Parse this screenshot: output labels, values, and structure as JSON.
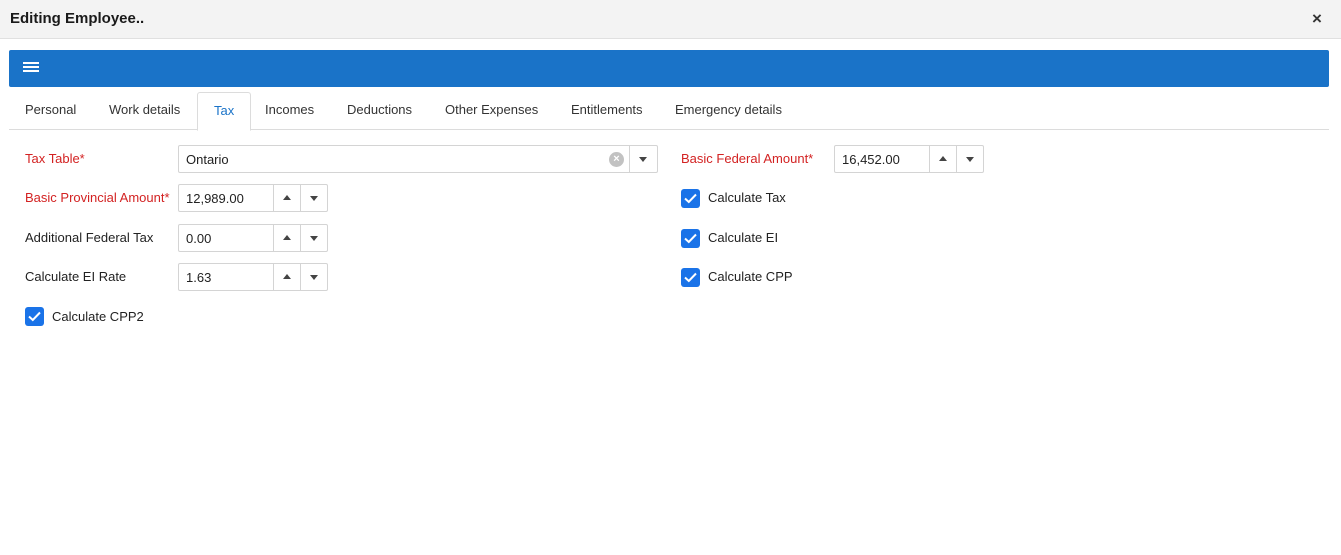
{
  "window": {
    "title": "Editing Employee..",
    "close_label": "×"
  },
  "tabs": [
    {
      "label": "Personal"
    },
    {
      "label": "Work details"
    },
    {
      "label": "Tax"
    },
    {
      "label": "Incomes"
    },
    {
      "label": "Deductions"
    },
    {
      "label": "Other Expenses"
    },
    {
      "label": "Entitlements"
    },
    {
      "label": "Emergency details"
    }
  ],
  "active_tab": "Tax",
  "form": {
    "tax_table": {
      "label": "Tax Table*",
      "value": "Ontario",
      "clear_label": "×"
    },
    "basic_provincial": {
      "label": "Basic Provincial Amount*",
      "value": "12,989.00"
    },
    "additional_federal": {
      "label": "Additional Federal Tax",
      "value": "0.00"
    },
    "ei_rate": {
      "label": "Calculate EI Rate",
      "value": "1.63"
    },
    "cpp2": {
      "label": "Calculate CPP2",
      "checked": true
    },
    "basic_federal": {
      "label": "Basic Federal Amount*",
      "value": "16,452.00"
    },
    "calc_tax": {
      "label": "Calculate Tax",
      "checked": true
    },
    "calc_ei": {
      "label": "Calculate EI",
      "checked": true
    },
    "calc_cpp": {
      "label": "Calculate CPP",
      "checked": true
    }
  },
  "colors": {
    "accent": "#1a73c8",
    "checkbox": "#1a73e8",
    "required_label": "#d32222"
  },
  "icons": {
    "menu": "hamburger-menu-icon",
    "close": "close-icon",
    "clear": "clear-circle-icon",
    "dropdown": "caret-down-icon",
    "spin_up": "caret-up-icon",
    "spin_down": "caret-down-icon",
    "check": "checkmark-icon"
  }
}
